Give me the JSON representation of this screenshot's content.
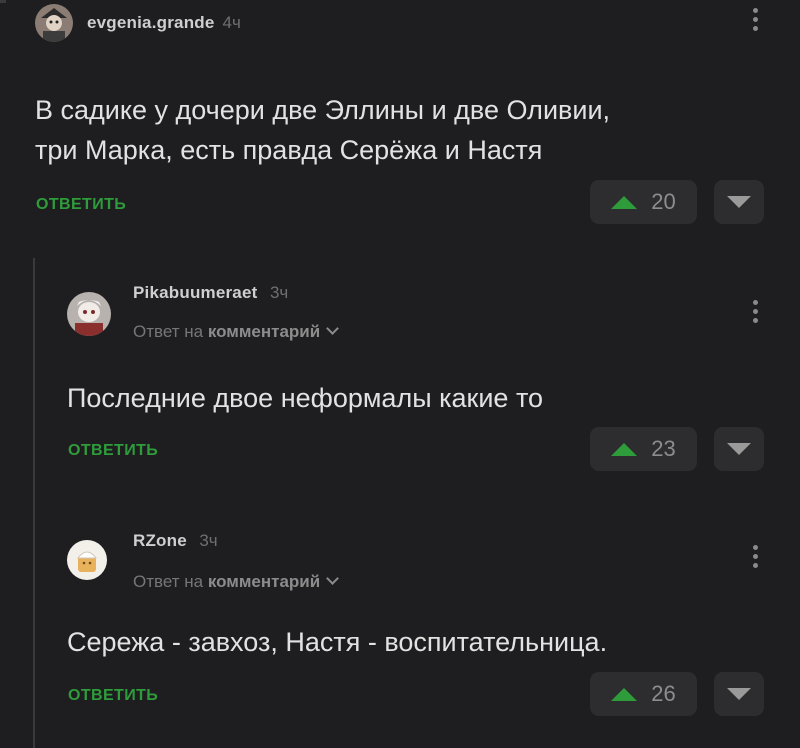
{
  "comments": [
    {
      "username": "evgenia.grande",
      "time": "4ч",
      "text_lines": [
        "В садике у дочери две Эллины и две Оливии,",
        "три Марка, есть правда Серёжа и Настя"
      ],
      "reply_label": "ОТВЕТИТЬ",
      "score": "20"
    },
    {
      "username": "Pikabuumeraet",
      "time": "3ч",
      "reply_to_prefix": "Ответ на",
      "reply_to_target": "комментарий",
      "text_lines": [
        "Последние двое неформалы какие то"
      ],
      "reply_label": "ОТВЕТИТЬ",
      "score": "23"
    },
    {
      "username": "RZone",
      "time": "3ч",
      "reply_to_prefix": "Ответ на",
      "reply_to_target": "комментарий",
      "text_lines": [
        "Сережа - завхоз, Настя - воспитательница."
      ],
      "reply_label": "ОТВЕТИТЬ",
      "score": "26"
    }
  ],
  "colors": {
    "background": "#1e1e20",
    "accent_green": "#2e9c3b",
    "button_bg": "#2d2d2f"
  },
  "icons": {
    "upvote": "triangle-up-icon",
    "downvote": "triangle-down-icon",
    "menu": "vertical-dots-icon",
    "expand": "chevron-down-icon"
  }
}
